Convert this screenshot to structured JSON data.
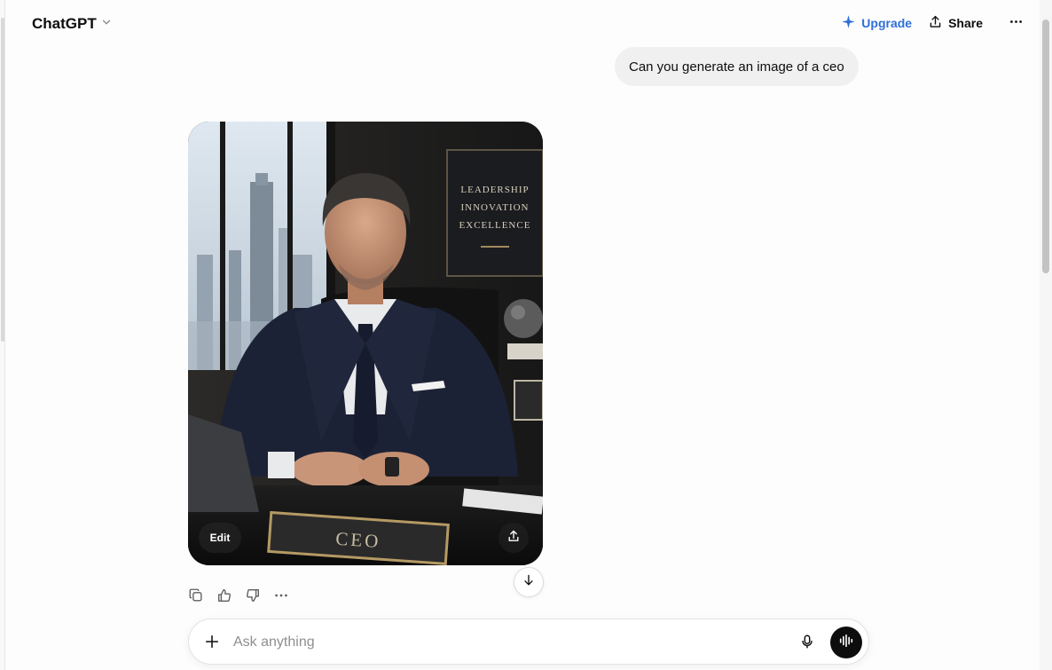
{
  "header": {
    "model_name": "ChatGPT",
    "upgrade_label": "Upgrade",
    "share_label": "Share"
  },
  "conversation": {
    "user_message": "Can you generate an image of a ceo",
    "generated_image": {
      "edit_label": "Edit",
      "wall_plaque_lines": [
        "LEADERSHIP",
        "INNOVATION",
        "EXCELLENCE"
      ],
      "nameplate_text": "CEO"
    }
  },
  "composer": {
    "placeholder": "Ask anything",
    "value": ""
  },
  "colors": {
    "accent_upgrade": "#2f6fd8",
    "user_bubble": "#f0f0f0",
    "voice_button": "#0d0d0d"
  },
  "icons": {
    "model_switcher": "chevron-down-icon",
    "upgrade": "sparkle-icon",
    "share": "share-upload-icon",
    "more": "more-horizontal-icon",
    "copy": "copy-icon",
    "thumbs_up": "thumbs-up-icon",
    "thumbs_down": "thumbs-down-icon",
    "scroll_down": "arrow-down-icon",
    "plus": "plus-icon",
    "mic": "microphone-icon",
    "voice": "voice-mode-icon"
  }
}
